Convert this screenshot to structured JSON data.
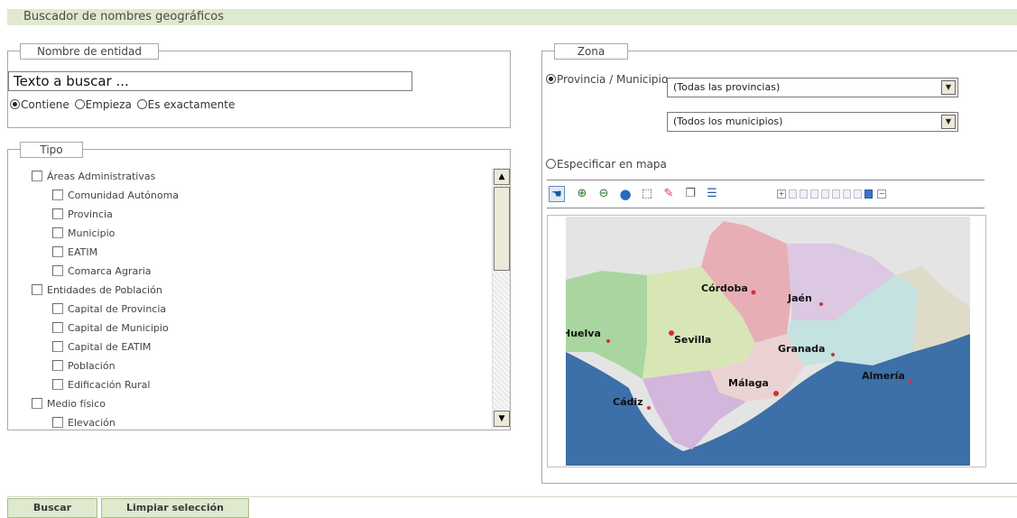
{
  "header": {
    "title": "Buscador de nombres geográficos"
  },
  "nombre": {
    "legend": "Nombre de entidad",
    "input_value": "Texto a buscar ...",
    "match_options": [
      {
        "label": "Contiene",
        "checked": true
      },
      {
        "label": "Empieza",
        "checked": false
      },
      {
        "label": "Es exactamente",
        "checked": false
      }
    ]
  },
  "tipo": {
    "legend": "Tipo",
    "items": [
      {
        "label": "Áreas Administrativas",
        "level": 0
      },
      {
        "label": "Comunidad Autónoma",
        "level": 1
      },
      {
        "label": "Provincia",
        "level": 1
      },
      {
        "label": "Municipio",
        "level": 1
      },
      {
        "label": "EATIM",
        "level": 1
      },
      {
        "label": "Comarca Agraria",
        "level": 1
      },
      {
        "label": "Entidades de Población",
        "level": 0
      },
      {
        "label": "Capital de Provincia",
        "level": 1
      },
      {
        "label": "Capital de Municipio",
        "level": 1
      },
      {
        "label": "Capital de EATIM",
        "level": 1
      },
      {
        "label": "Población",
        "level": 1
      },
      {
        "label": "Edificación Rural",
        "level": 1
      },
      {
        "label": "Medio físico",
        "level": 0
      },
      {
        "label": "Elevación",
        "level": 1
      }
    ]
  },
  "zona": {
    "legend": "Zona",
    "provincia_municipio_label": "Provincia / Municipio",
    "provincia_select": "(Todas las provincias)",
    "municipio_select": "(Todos los municipios)",
    "map_option_label": "Especificar en mapa",
    "map_labels": {
      "cordoba": "Córdoba",
      "jaen": "Jaén",
      "huelva": "Huelva",
      "sevilla": "Sevilla",
      "granada": "Granada",
      "malaga": "Málaga",
      "almeria": "Almería",
      "cadiz": "Cádiz"
    },
    "province_colors": {
      "huelva": "#a9d6a0",
      "sevilla": "#d8e6b6",
      "cordoba": "#e8aeb6",
      "jaen": "#dcc8e2",
      "granada": "#c4e2e0",
      "almeria": "#dedcc8",
      "malaga": "#ecd3d3",
      "cadiz": "#d2b6dc",
      "sea": "#3d6fa8"
    },
    "tools": [
      "pan-icon",
      "zoom-in-icon",
      "zoom-out-icon",
      "globe-icon",
      "select-box-icon",
      "eraser-icon",
      "copy-icon",
      "list-icon"
    ]
  },
  "actions": {
    "search_label": "Buscar",
    "clear_label": "Limpiar selección"
  }
}
